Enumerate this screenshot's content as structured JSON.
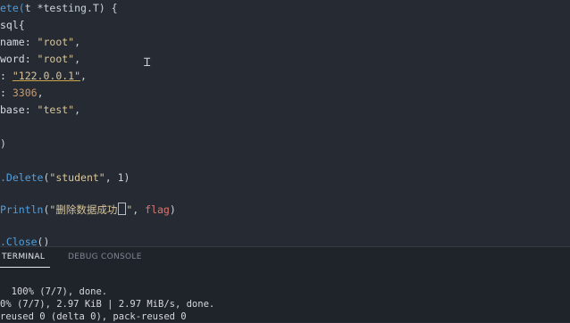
{
  "code_lines": [
    {
      "prefix": "ete(",
      "mid": "t *testing.T) {"
    },
    {
      "text": "sql{"
    },
    {
      "key": "name: ",
      "val": "\"root\"",
      "end": ","
    },
    {
      "key": "word: ",
      "val": "\"root\"",
      "end": ","
    },
    {
      "key": ": ",
      "val": "\"122.0.0.1\"",
      "end": ","
    },
    {
      "key": ": ",
      "val": "3306",
      "end": ","
    },
    {
      "key": "base: ",
      "val": "\"test\"",
      "end": ","
    },
    {
      "text": ")"
    },
    {
      "fn": ".Delete",
      "args_open": "(",
      "s": "\"student\"",
      "rest": ", 1)"
    },
    {
      "fn": "Println",
      "args_open": "(",
      "s": "\"删除数据成功",
      "s_end": "\"",
      "comma": ", ",
      "var": "flag",
      "close": ")"
    },
    {
      "fn": ".Close",
      "rest": "()"
    }
  ],
  "panel": {
    "tabs": [
      "TERMINAL",
      "DEBUG CONSOLE"
    ],
    "terminal_lines": [
      "  100% (7/7), done.",
      "0% (7/7), 2.97 KiB | 2.97 MiB/s, done.",
      "reused 0 (delta 0), pack-reused 0"
    ]
  }
}
